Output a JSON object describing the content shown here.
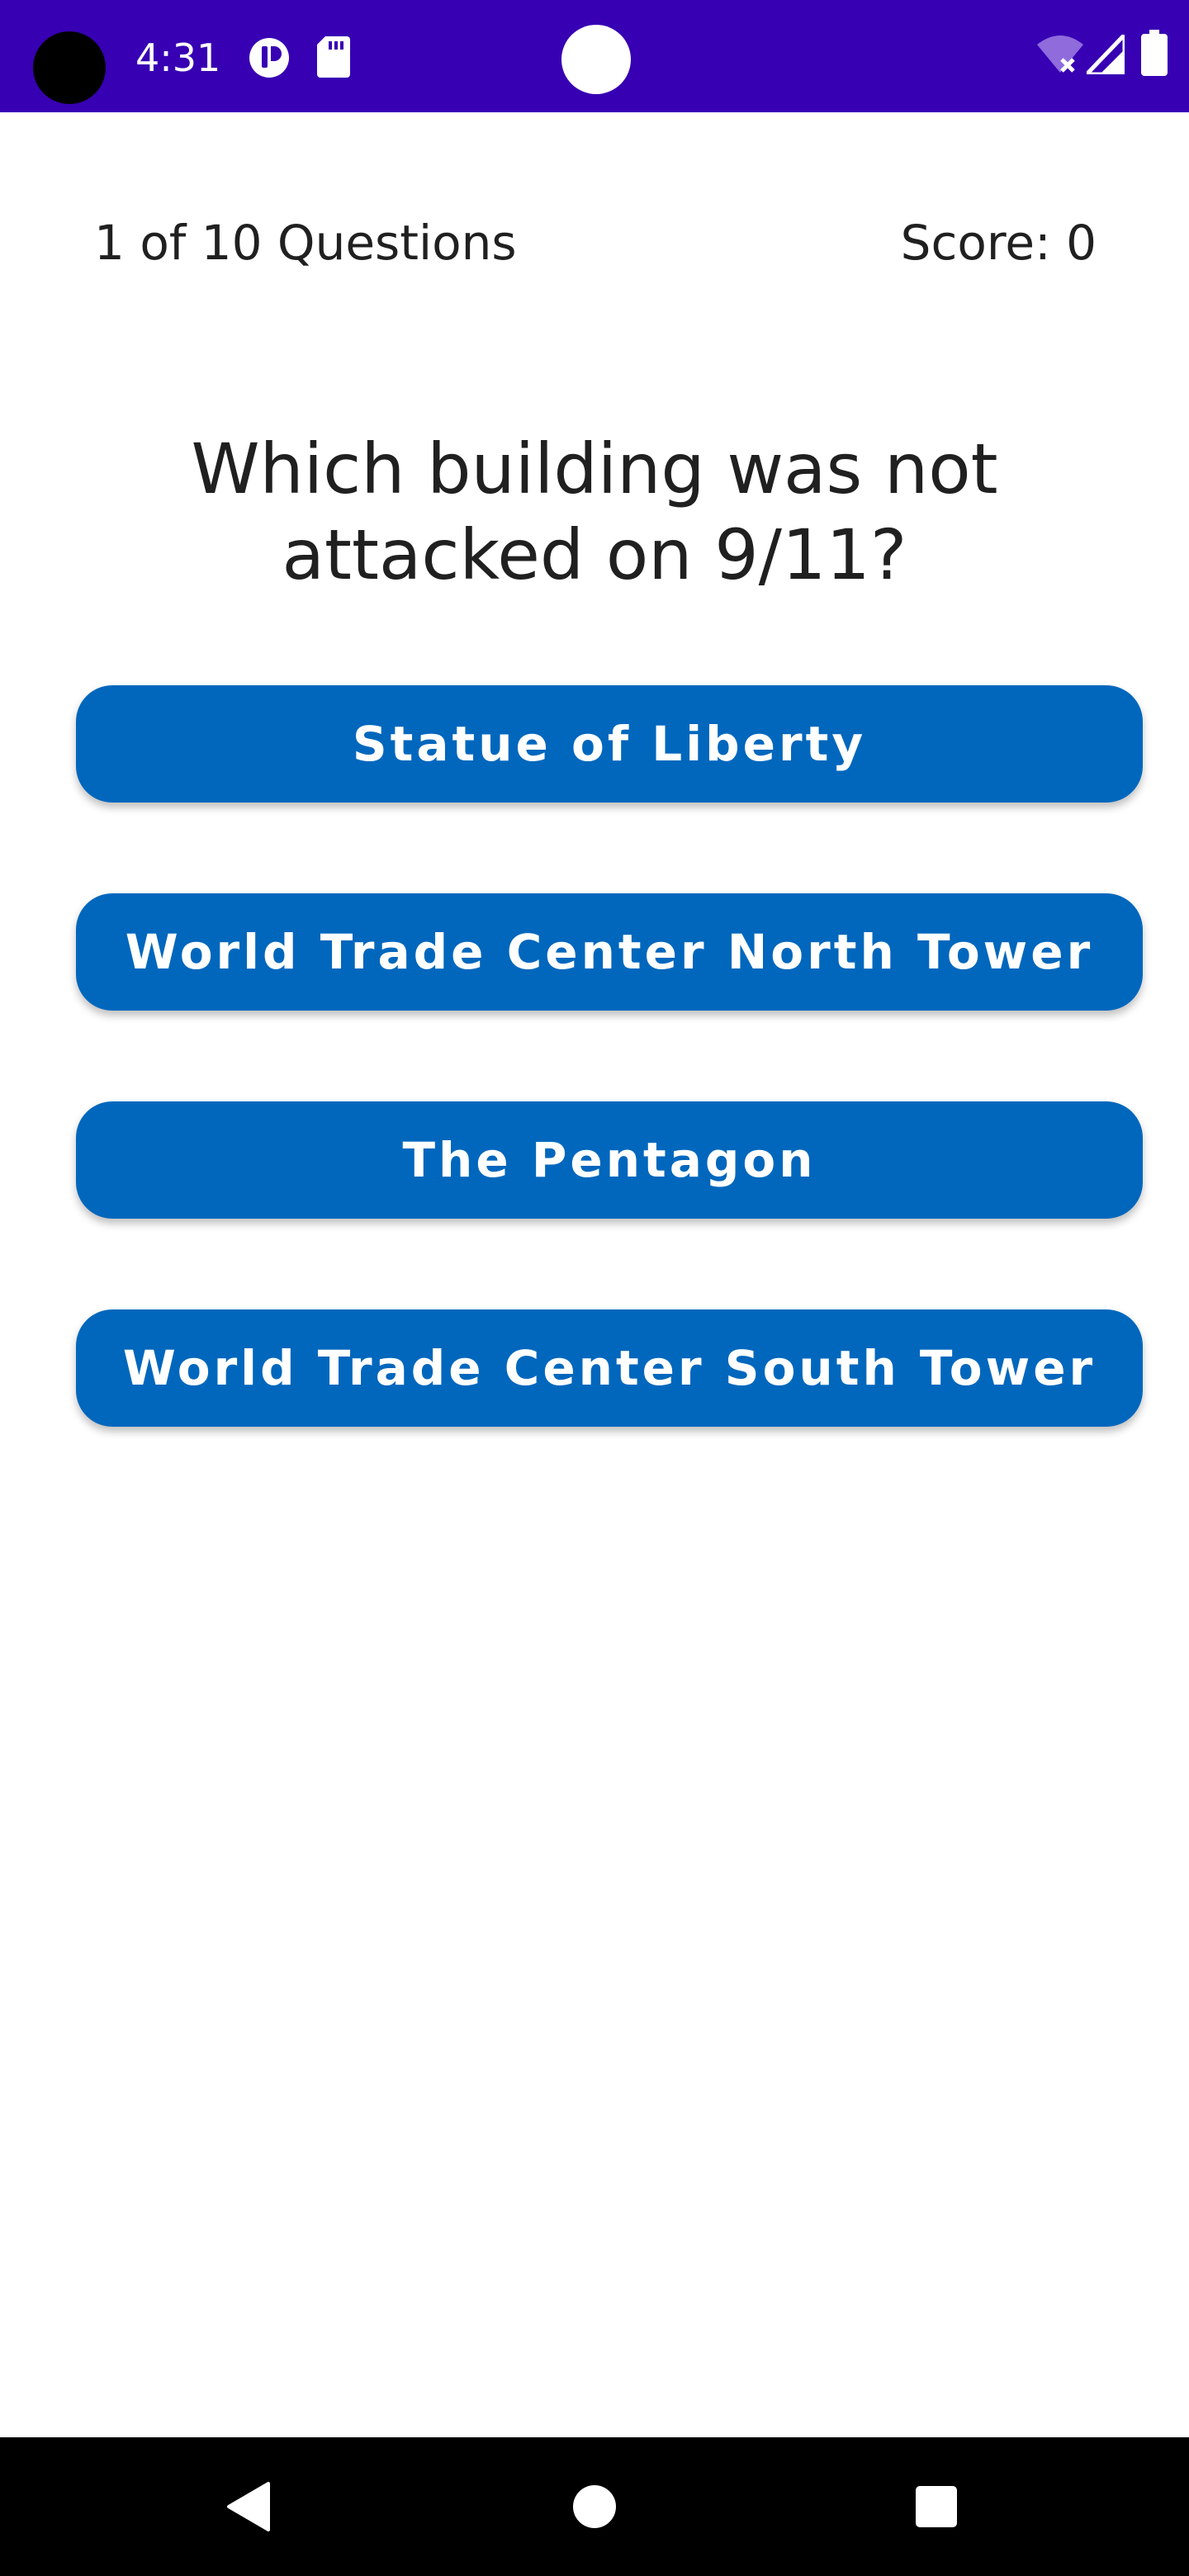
{
  "status_bar": {
    "time": "4:31",
    "icons": [
      "app-notification-icon",
      "sd-card-icon",
      "wifi-off-icon",
      "cell-signal-icon",
      "battery-icon"
    ],
    "background_color": "#3700b3"
  },
  "quiz": {
    "progress": "1 of 10 Questions",
    "score": "Score: 0",
    "question": "Which building was not attacked on 9/11?",
    "answers": [
      "Statue of Liberty",
      "World Trade Center North Tower",
      "The Pentagon",
      "World Trade Center South Tower"
    ],
    "button_color": "#0067bd"
  },
  "nav_bar": {
    "icons": [
      "back-icon",
      "home-icon",
      "recents-icon"
    ]
  }
}
